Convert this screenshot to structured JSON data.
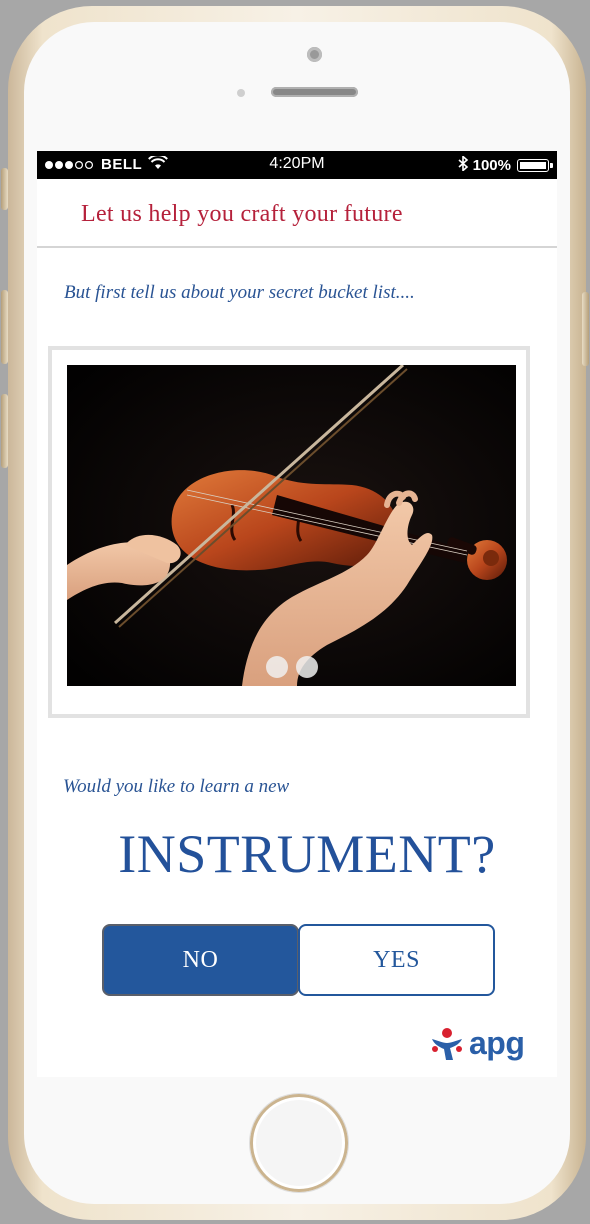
{
  "status_bar": {
    "carrier": "BELL",
    "time": "4:20PM",
    "battery_percent": "100%"
  },
  "header": {
    "title": "Let us help you craft your future"
  },
  "intro": {
    "text": "But first tell us about your secret bucket list...."
  },
  "carousel": {
    "image": "violin-photo",
    "page_count": 2
  },
  "question": {
    "prompt": "Would you like to learn a new",
    "subject": "INSTRUMENT?"
  },
  "actions": {
    "no_label": "NO",
    "yes_label": "YES"
  },
  "brand": {
    "logo_text": "apg"
  },
  "colors": {
    "title_red": "#b5213b",
    "brand_blue": "#23579c",
    "logo_red": "#d8202f"
  }
}
